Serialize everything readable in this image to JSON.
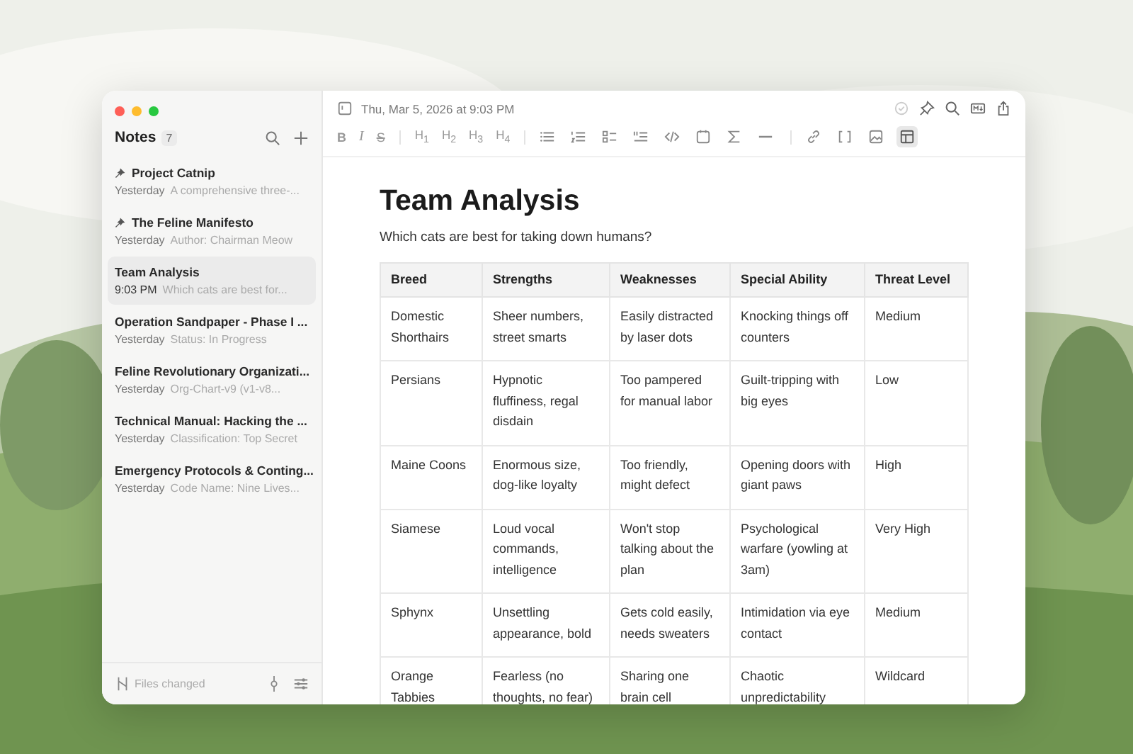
{
  "sidebar": {
    "title": "Notes",
    "count": "7",
    "notes": [
      {
        "title": "Project Catnip",
        "date": "Yesterday",
        "preview": "A comprehensive three-...",
        "pinned": true,
        "selected": false
      },
      {
        "title": "The Feline Manifesto",
        "date": "Yesterday",
        "preview": "Author: Chairman Meow",
        "pinned": true,
        "selected": false
      },
      {
        "title": "Team Analysis",
        "date": "9:03 PM",
        "preview": "Which cats are best for...",
        "pinned": false,
        "selected": true
      },
      {
        "title": "Operation Sandpaper - Phase I ...",
        "date": "Yesterday",
        "preview": "Status: In Progress",
        "pinned": false,
        "selected": false
      },
      {
        "title": "Feline Revolutionary Organizati...",
        "date": "Yesterday",
        "preview": "Org-Chart-v9 (v1-v8...",
        "pinned": false,
        "selected": false
      },
      {
        "title": "Technical Manual: Hacking the ...",
        "date": "Yesterday",
        "preview": "Classification: Top Secret",
        "pinned": false,
        "selected": false
      },
      {
        "title": "Emergency Protocols & Conting...",
        "date": "Yesterday",
        "preview": "Code Name: Nine Lives...",
        "pinned": false,
        "selected": false
      }
    ],
    "footer": "Files changed"
  },
  "editor": {
    "timestamp": "Thu, Mar 5, 2026 at 9:03 PM",
    "toolbar": {
      "format": [
        "B",
        "I",
        "S"
      ],
      "headings": [
        "H$_{1}$",
        "H$_{2}$",
        "H$_{3}$",
        "H$_{4}$"
      ],
      "table_selected": true
    },
    "title": "Team Analysis",
    "subtitle": "Which cats are best for taking down humans?",
    "table": {
      "columns": [
        "Breed",
        "Strengths",
        "Weaknesses",
        "Special Ability",
        "Threat Level"
      ],
      "rows": [
        [
          "Domestic Shorthairs",
          "Sheer numbers, street smarts",
          "Easily distracted by laser dots",
          "Knocking things off counters",
          "Medium"
        ],
        [
          "Persians",
          "Hypnotic fluffiness, regal disdain",
          "Too pampered for manual labor",
          "Guilt-tripping with big eyes",
          "Low"
        ],
        [
          "Maine Coons",
          "Enormous size, dog-like loyalty",
          "Too friendly, might defect",
          "Opening doors with giant paws",
          "High"
        ],
        [
          "Siamese",
          "Loud vocal commands, intelligence",
          "Won't stop talking about the plan",
          "Psychological warfare (yowling at 3am)",
          "Very High"
        ],
        [
          "Sphynx",
          "Unsettling appearance, bold",
          "Gets cold easily, needs sweaters",
          "Intimidation via eye contact",
          "Medium"
        ],
        [
          "Orange Tabbies",
          "Fearless (no thoughts, no fear)",
          "Sharing one brain cell",
          "Chaotic unpredictability",
          "Wildcard"
        ]
      ]
    }
  }
}
